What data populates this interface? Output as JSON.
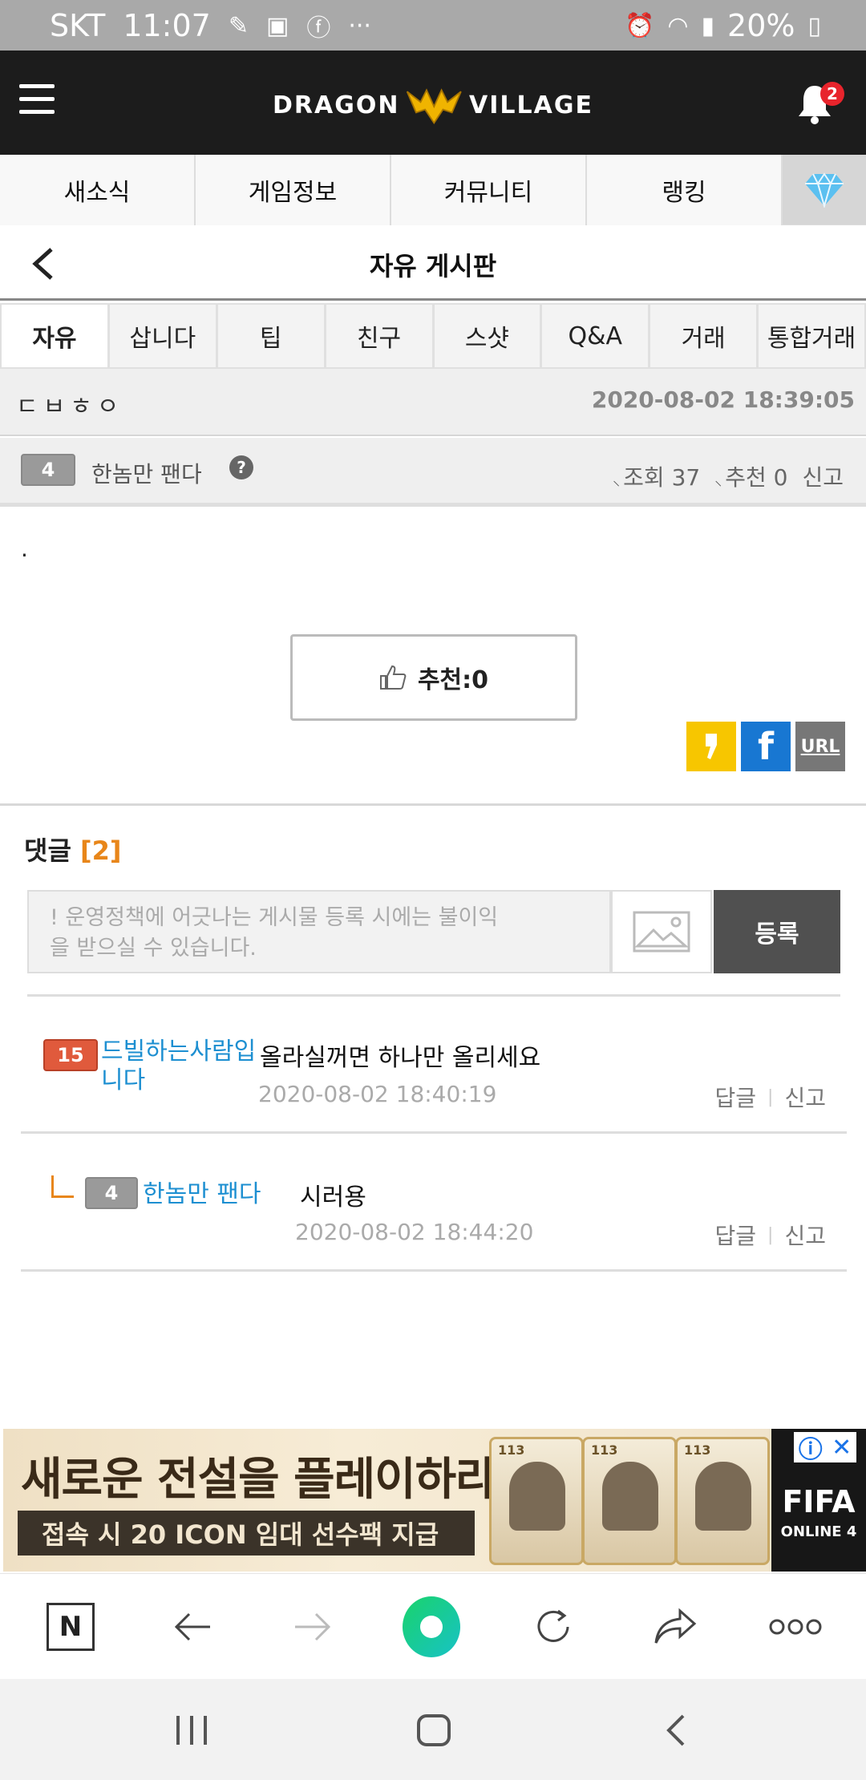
{
  "status_bar": {
    "carrier": "SKT",
    "time": "11:07",
    "more": "···",
    "battery": "20%"
  },
  "header": {
    "logo_left": "DRAGON",
    "logo_right": "VILLAGE",
    "notification_count": "2"
  },
  "main_nav": {
    "tabs": [
      "새소식",
      "게임정보",
      "커뮤니티",
      "랭킹"
    ],
    "gem_icon": "diamond-icon"
  },
  "board": {
    "title": "자유 게시판"
  },
  "categories": [
    "자유",
    "삽니다",
    "팁",
    "친구",
    "스샷",
    "Q&A",
    "거래",
    "통합거래"
  ],
  "post": {
    "title": "ㄷㅂㅎㅇ",
    "date": "2020-08-02 18:39:05",
    "author_level": "4",
    "author_name": "한놈만 팬다",
    "views": "조회 37",
    "recommends": "추천 0",
    "report": "신고",
    "body": ".",
    "like_label": "추천:0",
    "share": {
      "kakao": "kakao-icon",
      "facebook": "f",
      "url": "URL"
    }
  },
  "comments_section": {
    "label": "댓글",
    "count": "[2]",
    "placeholder_line1": "! 운영정책에 어긋나는 게시물 등록 시에는 불이익",
    "placeholder_line2": "을 받으실 수 있습니다.",
    "submit_label": "등록",
    "items": [
      {
        "level": "15",
        "name": "드빌하는사람입니다",
        "text": "올라실꺼면 하나만 올리세요",
        "date": "2020-08-02 18:40:19",
        "reply": "답글",
        "report": "신고"
      },
      {
        "level": "4",
        "name": "한놈만 팬다",
        "text": "시러용",
        "date": "2020-08-02 18:44:20",
        "reply": "답글",
        "report": "신고"
      }
    ]
  },
  "ad": {
    "headline": "새로운 전설을 플레이하라!",
    "subline": "접속 시 20 ICON 임대 선수팩 지급",
    "brand": "FIFA",
    "brand_sub": "ONLINE 4",
    "card_rating": "113"
  },
  "colors": {
    "accent_orange": "#e8861a",
    "link_blue": "#1d8fd1",
    "header_bg": "#1c1c1c"
  }
}
